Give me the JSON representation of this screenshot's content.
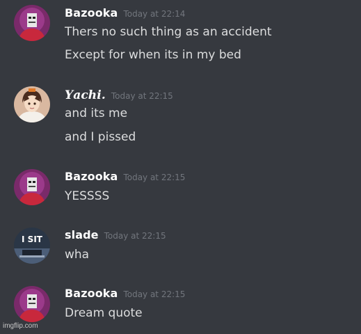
{
  "messages": [
    {
      "username": "Bazooka",
      "timestamp": "Today at 22:14",
      "avatar_icon": "bazooka-avatar-icon",
      "lines": [
        "Thers no such thing as an accident",
        "Except for when its in my bed"
      ]
    },
    {
      "username": "𝒀𝒂𝒄𝒉𝒊.",
      "timestamp": "Today at 22:15",
      "avatar_icon": "anime-girl-avatar-icon",
      "lines": [
        "and its me",
        "and I pissed"
      ]
    },
    {
      "username": "Bazooka",
      "timestamp": "Today at 22:15",
      "avatar_icon": "bazooka-avatar-icon",
      "lines": [
        "YESSSS"
      ]
    },
    {
      "username": "slade",
      "timestamp": "Today at 22:15",
      "avatar_icon": "i-sit-avatar-icon",
      "avatar_text": "I SIT",
      "lines": [
        "wha"
      ]
    },
    {
      "username": "Bazooka",
      "timestamp": "Today at 22:15",
      "avatar_icon": "bazooka-avatar-icon",
      "lines": [
        "Dream quote"
      ]
    }
  ],
  "watermark": "imgflip.com",
  "colors": {
    "background": "#36393f",
    "username": "#ffffff",
    "timestamp": "#72767d",
    "message_text": "#dcddde"
  }
}
